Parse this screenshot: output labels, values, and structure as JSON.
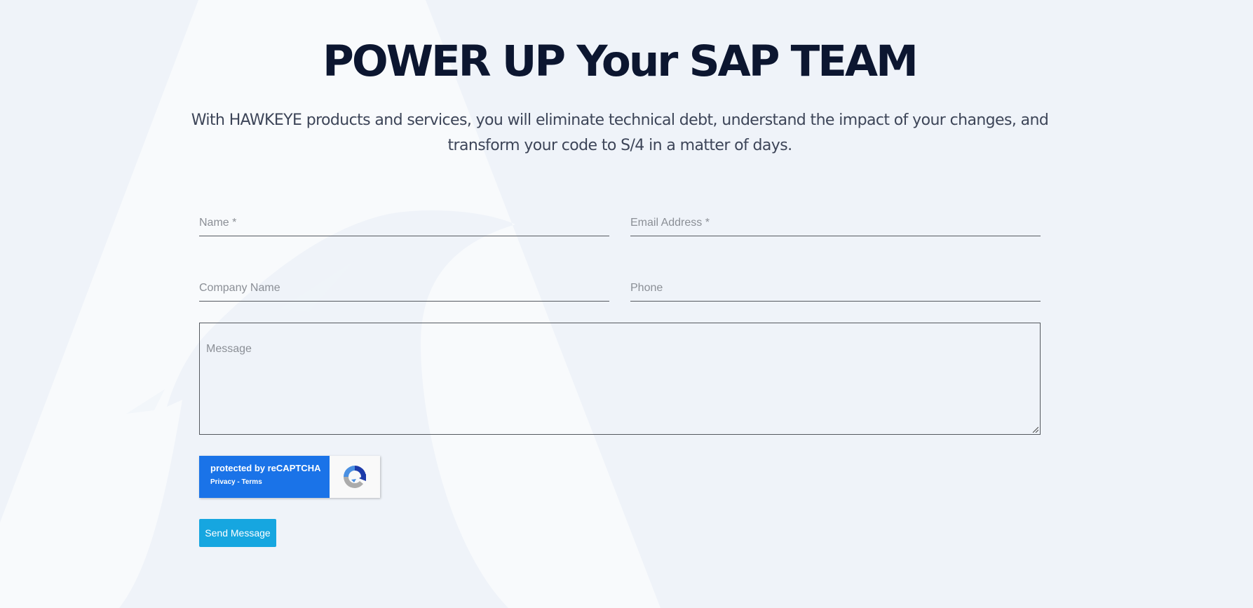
{
  "hero": {
    "title": "POWER UP Your SAP TEAM",
    "subtitle": "With HAWKEYE products and services, you will eliminate technical debt, understand the impact of your changes, and transform your code to S/4 in a matter of days."
  },
  "form": {
    "name_placeholder": "Name *",
    "email_placeholder": "Email Address *",
    "company_placeholder": "Company Name",
    "phone_placeholder": "Phone",
    "message_placeholder": "Message",
    "submit_label": "Send Message"
  },
  "recaptcha": {
    "protected_label": "protected by reCAPTCHA",
    "privacy_label": "Privacy",
    "separator": " - ",
    "terms_label": "Terms",
    "icon": "recaptcha-logo-icon"
  },
  "colors": {
    "background": "#eff3f9",
    "title": "#0c1630",
    "button": "#16a6e0",
    "recaptcha_badge": "#1a73e8"
  }
}
